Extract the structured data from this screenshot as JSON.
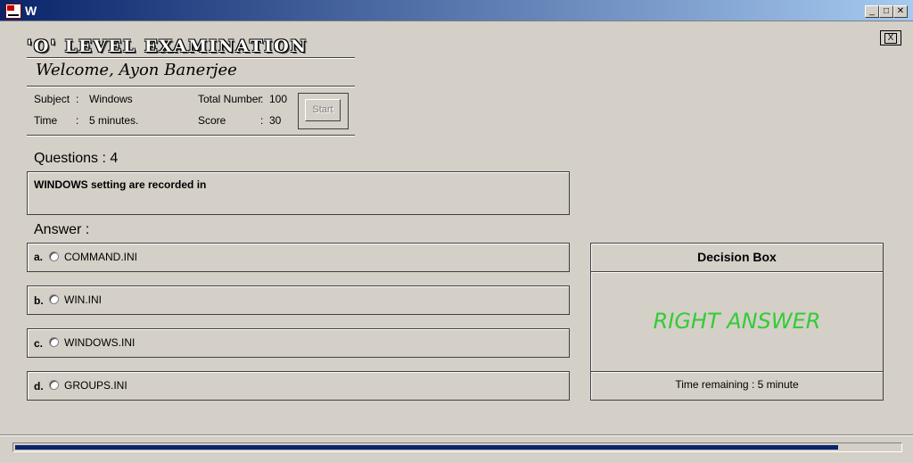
{
  "window": {
    "title": "W",
    "minimize_glyph": "_",
    "maximize_glyph": "□",
    "close_glyph": "✕"
  },
  "dialog": {
    "close_label": "X"
  },
  "header": {
    "title": "'O' LEVEL EXAMINATION",
    "welcome": "Welcome,   Ayon Banerjee"
  },
  "info": {
    "subject_label": "Subject",
    "subject_sep": ":",
    "subject_value": "Windows",
    "time_label": "Time",
    "time_sep": ":",
    "time_value": "5 minutes.",
    "total_label": "Total Number",
    "total_sep": ":",
    "total_value": "100",
    "score_label": "Score",
    "score_sep": ":",
    "score_value": "30",
    "start_label": "Start"
  },
  "question": {
    "label": "Questions : 4",
    "text": "WINDOWS setting are recorded in"
  },
  "answer": {
    "label": "Answer :",
    "options": [
      {
        "letter": "a.",
        "text": "COMMAND.INI"
      },
      {
        "letter": "b.",
        "text": "WIN.INI"
      },
      {
        "letter": "c.",
        "text": "WINDOWS.INI"
      },
      {
        "letter": "d.",
        "text": "GROUPS.INI"
      }
    ]
  },
  "decision": {
    "title": "Decision Box",
    "result": "RIGHT ANSWER",
    "result_color": "#33cc33",
    "time_remaining_label": "Time remaining  :    5 minute"
  },
  "progress": {
    "value": 0.93
  }
}
